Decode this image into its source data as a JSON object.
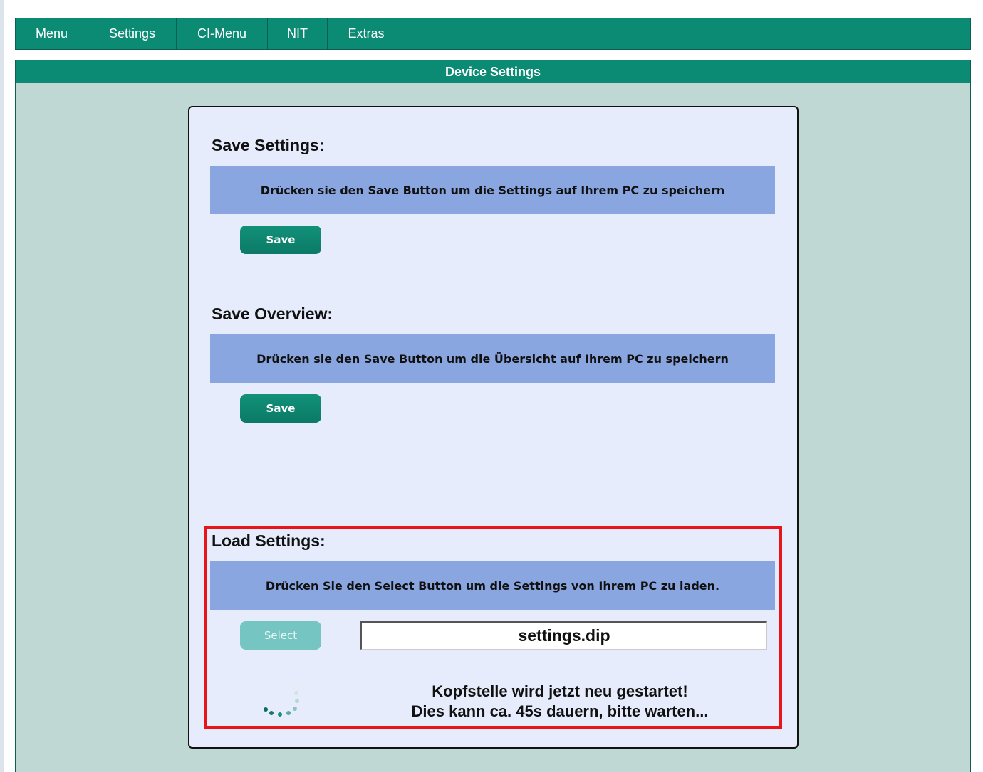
{
  "nav": {
    "items": [
      {
        "label": "Menu"
      },
      {
        "label": "Settings"
      },
      {
        "label": "CI-Menu"
      },
      {
        "label": "NIT"
      },
      {
        "label": "Extras"
      }
    ]
  },
  "panel": {
    "title": "Device Settings"
  },
  "save_settings": {
    "title": "Save Settings:",
    "info": "Drücken sie den Save Button um die Settings auf Ihrem PC zu speichern",
    "button": "Save"
  },
  "save_overview": {
    "title": "Save Overview:",
    "info": "Drücken sie den Save Button um die Übersicht auf Ihrem PC zu speichern",
    "button": "Save"
  },
  "load_settings": {
    "title": "Load Settings:",
    "info": "Drücken Sie den Select Button um die Settings von Ihrem PC zu laden.",
    "button": "Select",
    "file_name": "settings.dip",
    "status_line1": "Kopfstelle wird jetzt neu gestartet!",
    "status_line2": "Dies kann ca. 45s dauern, bitte warten..."
  },
  "colors": {
    "nav_bg": "#0b8a74",
    "panel_bg": "#bfd8d4",
    "card_bg": "#e6ecfb",
    "info_bar": "#8aa6e0",
    "button": "#0b8a74",
    "button_disabled": "#75c5c2",
    "highlight": "#e8141a"
  },
  "icons": {
    "spinner": "loading-spinner-icon"
  }
}
